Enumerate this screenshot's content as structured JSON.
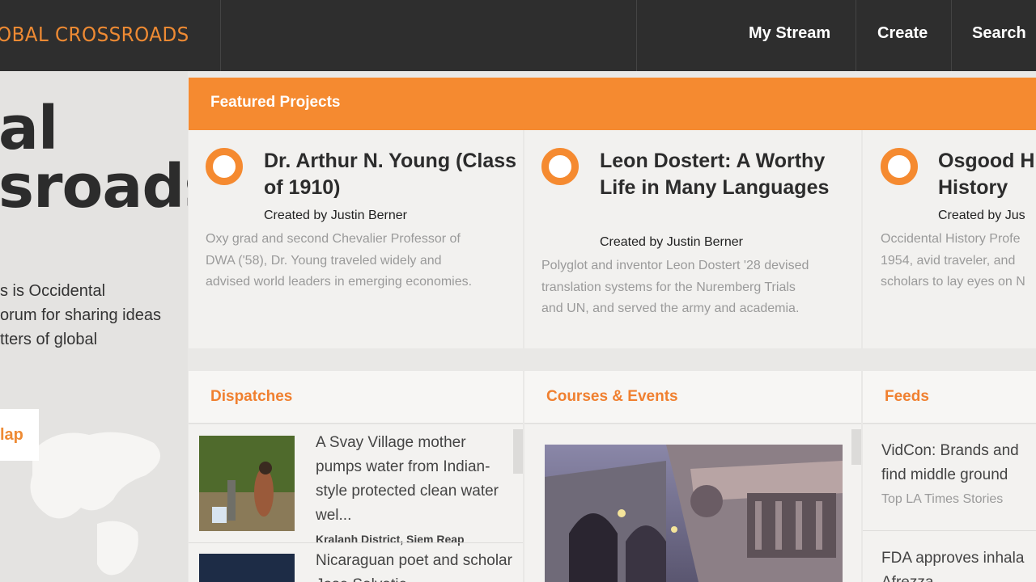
{
  "header": {
    "logo": "OBAL CROSSROADS",
    "nav": [
      "My Stream",
      "Create",
      "Search"
    ]
  },
  "hero": {
    "title_line1": "al",
    "title_line2": "sroads",
    "blurb_lines": [
      "s is Occidental",
      "orum for sharing ideas",
      "tters of global"
    ],
    "map_button": "lap"
  },
  "featured": {
    "heading": "Featured Projects",
    "cards": [
      {
        "title": "Dr. Arthur N. Young (Class of 1910)",
        "creator": "Created by Justin Berner",
        "description": "Oxy grad and second Chevalier Professor of DWA ('58), Dr. Young traveled widely and advised world leaders in emerging economies."
      },
      {
        "title": "Leon Dostert: A Worthy Life in Many Languages",
        "creator": "Created by Justin Berner",
        "description": "Polyglot and inventor Leon Dostert '28 devised translation systems for the Nuremberg Trials and UN, and served the army and academia."
      },
      {
        "title": "Osgood H History",
        "creator": "Created by Jus",
        "description": "Occidental History Profe 1954, avid traveler, and scholars to lay eyes on N"
      }
    ]
  },
  "dispatches": {
    "heading": "Dispatches",
    "items": [
      {
        "text": "A Svay Village mother pumps water from Indian-style protected clean water wel...",
        "meta": "Kralanh District, Siem Reap"
      },
      {
        "text": "Nicaraguan poet and scholar Jose Salvatie..."
      }
    ]
  },
  "courses": {
    "heading": "Courses & Events"
  },
  "feeds": {
    "heading": "Feeds",
    "items": [
      {
        "title_lines": [
          "VidCon: Brands and",
          "find middle ground"
        ],
        "source": "Top LA Times Stories"
      },
      {
        "title_lines": [
          "FDA approves inhala",
          "Afrezza"
        ]
      }
    ]
  },
  "colors": {
    "accent": "#f58a30",
    "header_bg": "#2e2e2e"
  }
}
